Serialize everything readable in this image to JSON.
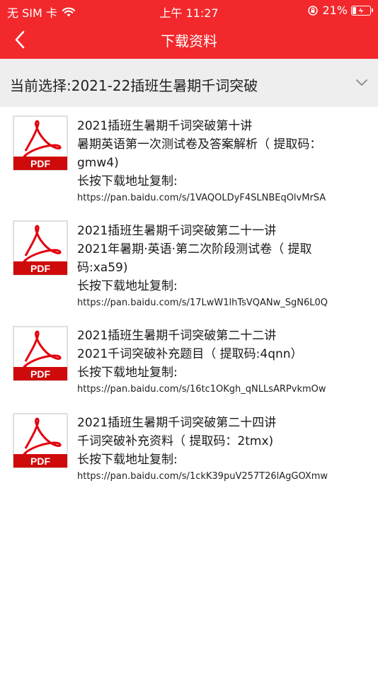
{
  "status_bar": {
    "carrier": "无 SIM 卡",
    "time": "上午 11:27",
    "battery_percent": "21%",
    "battery_level": 0.21
  },
  "nav": {
    "title": "下载资料",
    "back_icon": "chevron-left-icon"
  },
  "filter": {
    "label": "当前选择:2021-22插班生暑期千词突破",
    "icon": "chevron-down-icon"
  },
  "colors": {
    "brand_red": "#f2282c",
    "filter_bg": "#eeeeee"
  },
  "items": [
    {
      "icon": "pdf-file-icon",
      "line1": "2021插班生暑期千词突破第十讲",
      "line2": "暑期英语第一次测试卷及答案解析（ 提取码：",
      "line3": "gmw4)",
      "copy_label": "长按下载地址复制:",
      "url": "https://pan.baidu.com/s/1VAQOLDyF4SLNBEqOlvMrSA"
    },
    {
      "icon": "pdf-file-icon",
      "line1": "2021插班生暑期千词突破第二十一讲",
      "line2": "2021年暑期·英语·第二次阶段测试卷（ 提取",
      "line3": "码:xa59)",
      "copy_label": "长按下载地址复制:",
      "url": "https://pan.baidu.com/s/17LwW1lhTsVQANw_SgN6L0Q"
    },
    {
      "icon": "pdf-file-icon",
      "line1": "2021插班生暑期千词突破第二十二讲",
      "line2": "2021千词突破补充题目（ 提取码:4qnn）",
      "copy_label": "长按下载地址复制:",
      "url": "https://pan.baidu.com/s/16tc1OKgh_qNLLsARPvkmOw"
    },
    {
      "icon": "pdf-file-icon",
      "line1": "2021插班生暑期千词突破第二十四讲",
      "line2": "千词突破补充资料（ 提取码：2tmx)",
      "copy_label": "长按下载地址复制:",
      "url": "https://pan.baidu.com/s/1ckK39puV257T26lAgGOXmw"
    }
  ],
  "pdf_badge": "PDF"
}
